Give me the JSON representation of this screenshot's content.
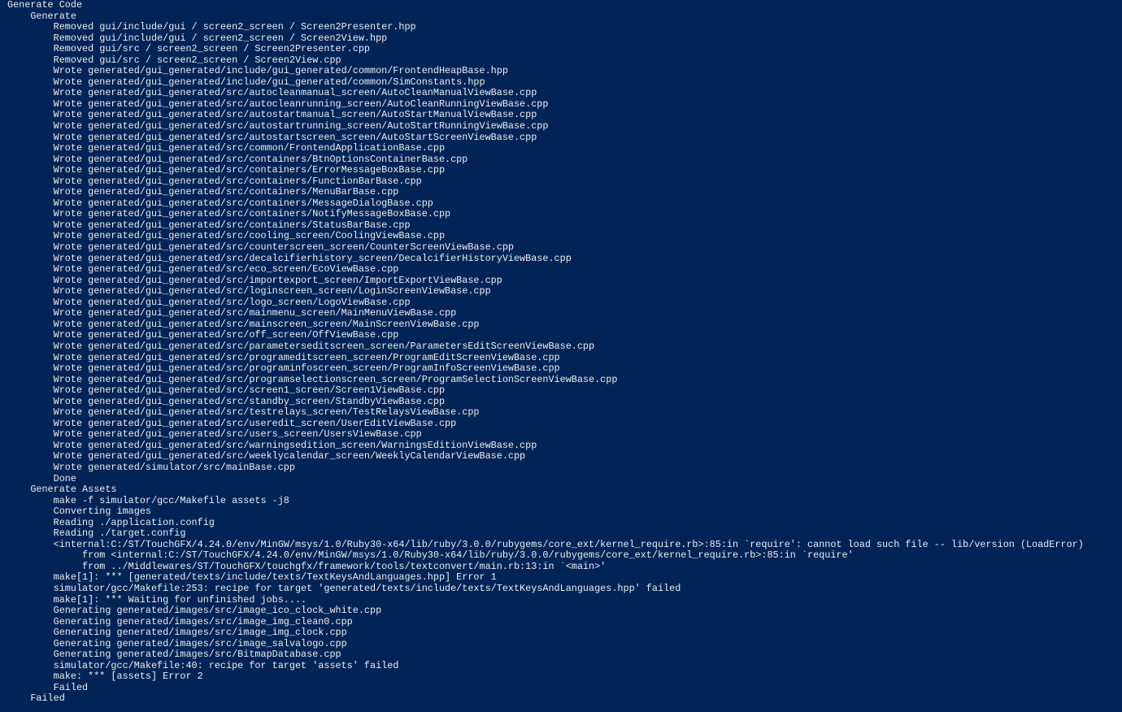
{
  "terminal": {
    "background": "#012456",
    "foreground": "#EEEDF0",
    "lines": [
      "Generate Code",
      "    Generate",
      "        Removed gui/include/gui / screen2_screen / Screen2Presenter.hpp",
      "        Removed gui/include/gui / screen2_screen / Screen2View.hpp",
      "        Removed gui/src / screen2_screen / Screen2Presenter.cpp",
      "        Removed gui/src / screen2_screen / Screen2View.cpp",
      "        Wrote generated/gui_generated/include/gui_generated/common/FrontendHeapBase.hpp",
      "        Wrote generated/gui_generated/include/gui_generated/common/SimConstants.hpp",
      "        Wrote generated/gui_generated/src/autocleanmanual_screen/AutoCleanManualViewBase.cpp",
      "        Wrote generated/gui_generated/src/autocleanrunning_screen/AutoCleanRunningViewBase.cpp",
      "        Wrote generated/gui_generated/src/autostartmanual_screen/AutoStartManualViewBase.cpp",
      "        Wrote generated/gui_generated/src/autostartrunning_screen/AutoStartRunningViewBase.cpp",
      "        Wrote generated/gui_generated/src/autostartscreen_screen/AutoStartScreenViewBase.cpp",
      "        Wrote generated/gui_generated/src/common/FrontendApplicationBase.cpp",
      "        Wrote generated/gui_generated/src/containers/BtnOptionsContainerBase.cpp",
      "        Wrote generated/gui_generated/src/containers/ErrorMessageBoxBase.cpp",
      "        Wrote generated/gui_generated/src/containers/FunctionBarBase.cpp",
      "        Wrote generated/gui_generated/src/containers/MenuBarBase.cpp",
      "        Wrote generated/gui_generated/src/containers/MessageDialogBase.cpp",
      "        Wrote generated/gui_generated/src/containers/NotifyMessageBoxBase.cpp",
      "        Wrote generated/gui_generated/src/containers/StatusBarBase.cpp",
      "        Wrote generated/gui_generated/src/cooling_screen/CoolingViewBase.cpp",
      "        Wrote generated/gui_generated/src/counterscreen_screen/CounterScreenViewBase.cpp",
      "        Wrote generated/gui_generated/src/decalcifierhistory_screen/DecalcifierHistoryViewBase.cpp",
      "        Wrote generated/gui_generated/src/eco_screen/EcoViewBase.cpp",
      "        Wrote generated/gui_generated/src/importexport_screen/ImportExportViewBase.cpp",
      "        Wrote generated/gui_generated/src/loginscreen_screen/LoginScreenViewBase.cpp",
      "        Wrote generated/gui_generated/src/logo_screen/LogoViewBase.cpp",
      "        Wrote generated/gui_generated/src/mainmenu_screen/MainMenuViewBase.cpp",
      "        Wrote generated/gui_generated/src/mainscreen_screen/MainScreenViewBase.cpp",
      "        Wrote generated/gui_generated/src/off_screen/OffViewBase.cpp",
      "        Wrote generated/gui_generated/src/parameterseditscreen_screen/ParametersEditScreenViewBase.cpp",
      "        Wrote generated/gui_generated/src/programeditscreen_screen/ProgramEditScreenViewBase.cpp",
      "        Wrote generated/gui_generated/src/programinfoscreen_screen/ProgramInfoScreenViewBase.cpp",
      "        Wrote generated/gui_generated/src/programselectionscreen_screen/ProgramSelectionScreenViewBase.cpp",
      "        Wrote generated/gui_generated/src/screen1_screen/Screen1ViewBase.cpp",
      "        Wrote generated/gui_generated/src/standby_screen/StandbyViewBase.cpp",
      "        Wrote generated/gui_generated/src/testrelays_screen/TestRelaysViewBase.cpp",
      "        Wrote generated/gui_generated/src/useredit_screen/UserEditViewBase.cpp",
      "        Wrote generated/gui_generated/src/users_screen/UsersViewBase.cpp",
      "        Wrote generated/gui_generated/src/warningsedition_screen/WarningsEditionViewBase.cpp",
      "        Wrote generated/gui_generated/src/weeklycalendar_screen/WeeklyCalendarViewBase.cpp",
      "        Wrote generated/simulator/src/mainBase.cpp",
      "        Done",
      "    Generate Assets",
      "        make -f simulator/gcc/Makefile assets -j8",
      "        Converting images",
      "        Reading ./application.config",
      "        Reading ./target.config",
      "        <internal:C:/ST/TouchGFX/4.24.0/env/MinGW/msys/1.0/Ruby30-x64/lib/ruby/3.0.0/rubygems/core_ext/kernel_require.rb>:85:in `require': cannot load such file -- lib/version (LoadError)",
      "             from <internal:C:/ST/TouchGFX/4.24.0/env/MinGW/msys/1.0/Ruby30-x64/lib/ruby/3.0.0/rubygems/core_ext/kernel_require.rb>:85:in `require'",
      "             from ../Middlewares/ST/TouchGFX/touchgfx/framework/tools/textconvert/main.rb:13:in `<main>'",
      "        make[1]: *** [generated/texts/include/texts/TextKeysAndLanguages.hpp] Error 1",
      "        simulator/gcc/Makefile:253: recipe for target 'generated/texts/include/texts/TextKeysAndLanguages.hpp' failed",
      "        make[1]: *** Waiting for unfinished jobs....",
      "        Generating generated/images/src/image_ico_clock_white.cpp",
      "        Generating generated/images/src/image_img_clean0.cpp",
      "        Generating generated/images/src/image_img_clock.cpp",
      "        Generating generated/images/src/image_salvalogo.cpp",
      "        Generating generated/images/src/BitmapDatabase.cpp",
      "        simulator/gcc/Makefile:40: recipe for target 'assets' failed",
      "        make: *** [assets] Error 2",
      "        Failed",
      "    Failed"
    ]
  }
}
